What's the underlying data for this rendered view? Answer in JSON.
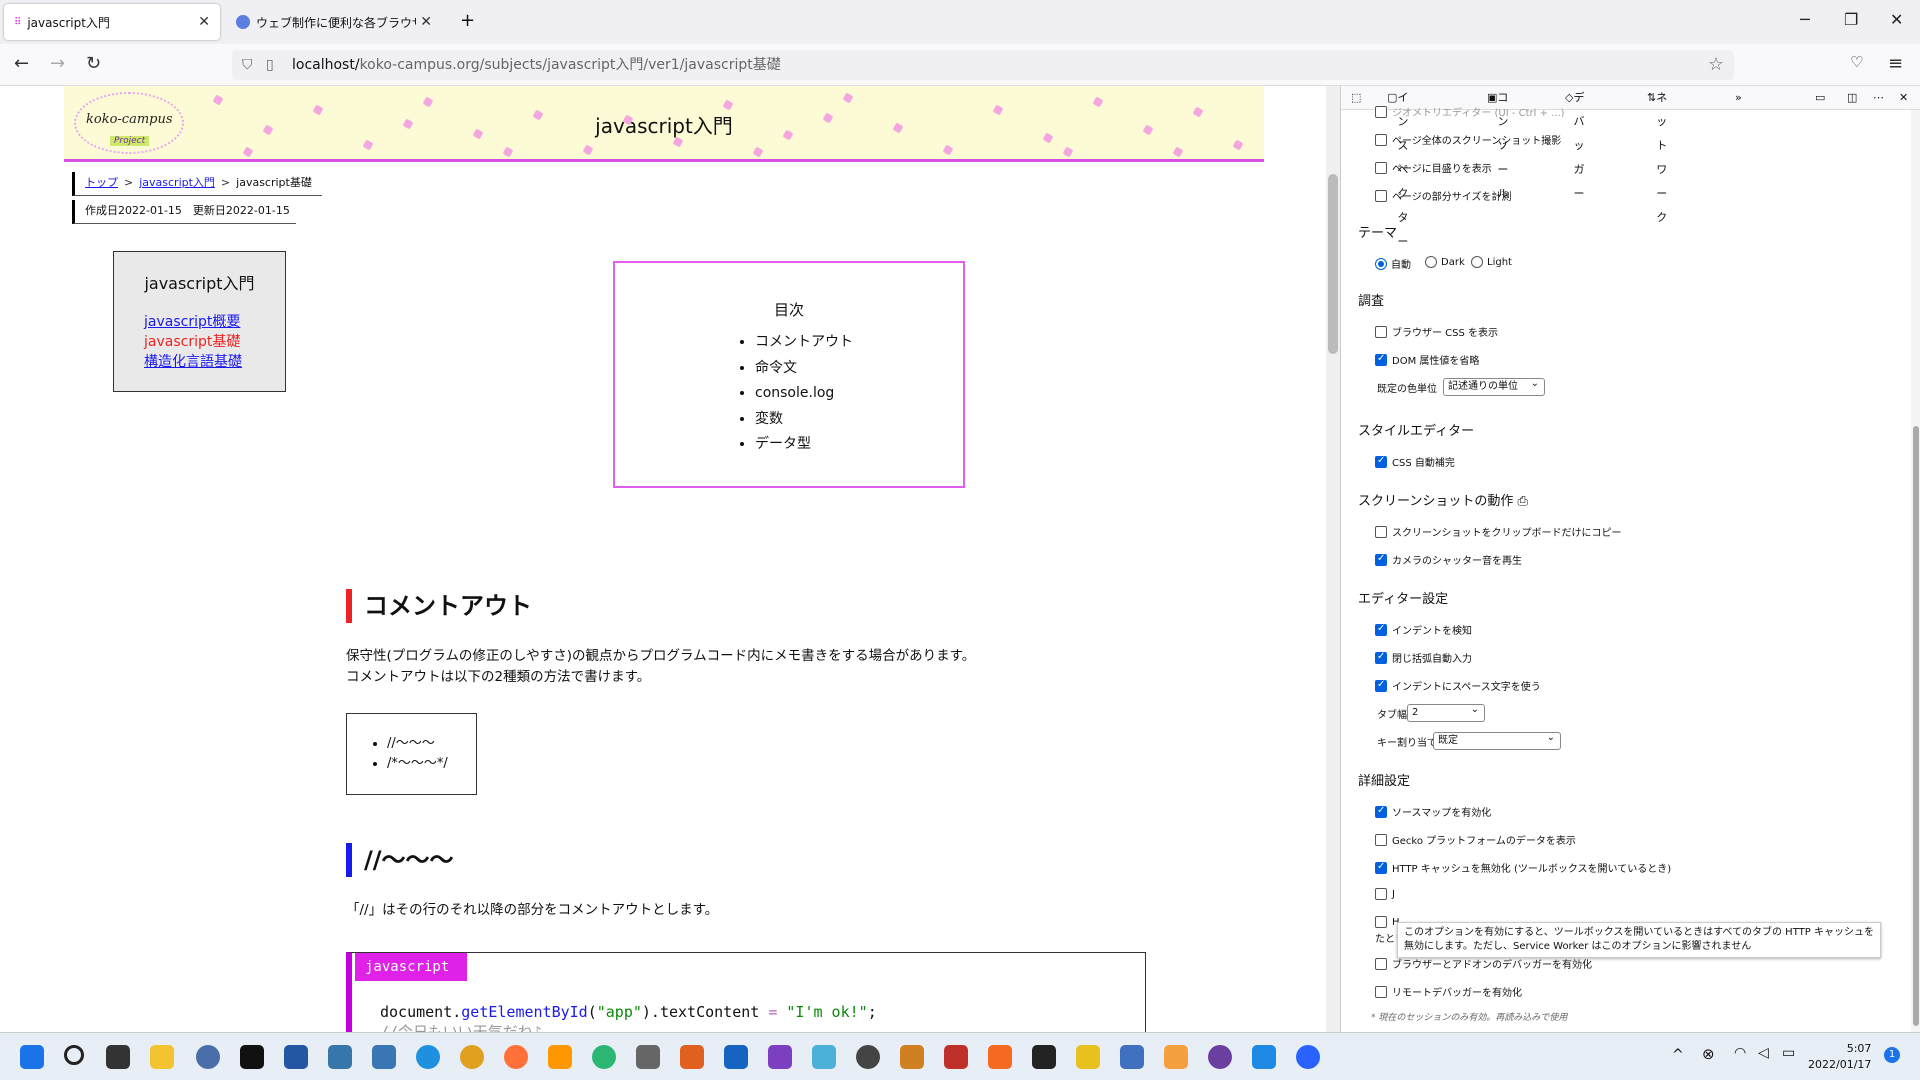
{
  "browser": {
    "tabs": [
      {
        "title": "javascript入門"
      },
      {
        "title": "ウェブ制作に便利な各ブラウザの開発..."
      }
    ],
    "new_tab": "+",
    "url_prefix": "localhost/",
    "url_rest": "koko-campus.org/subjects/javascript入門/ver1/javascript基礎",
    "window_controls": {
      "minimize": "─",
      "restore": "❐",
      "close": "✕"
    }
  },
  "page": {
    "site_title": "javascript入門",
    "logo_text": "koko-campus",
    "logo_sub": "Project",
    "breadcrumb": {
      "top": "トップ",
      "course": "javascript入門",
      "current": "javascript基礎",
      "sep": ">"
    },
    "dates": "作成日2022-01-15　更新日2022-01-15",
    "sidebar": {
      "title": "javascript入門",
      "links": [
        "javascript概要",
        "javascript基礎",
        "構造化言語基礎"
      ]
    },
    "toc": {
      "title": "目次",
      "items": [
        "コメントアウト",
        "命令文",
        "console.log",
        "変数",
        "データ型"
      ]
    },
    "section1": {
      "heading": "コメントアウト",
      "line1": "保守性(プログラムの修正のしやすさ)の観点からプログラムコード内にメモ書きをする場合があります。",
      "line2": "コメントアウトは以下の2種類の方法で書けます。",
      "list": [
        "//～～～",
        "/*～～～*/"
      ]
    },
    "section2": {
      "heading": "//～～～",
      "text": "「//」はその行のそれ以降の部分をコメントアウトとします。",
      "code_lang": "javascript",
      "code": {
        "obj": "document",
        "dot": ".",
        "fn": "getElementById",
        "arg": "\"app\"",
        "prop": ").textContent ",
        "eq": "=",
        "val": " \"I'm ok!\"",
        "end": ";",
        "comment": "//今日もいい天気だね♪"
      }
    }
  },
  "devtools": {
    "tabs": [
      "インスペクター",
      "コンソール",
      "デバッガー",
      "ネットワーク"
    ],
    "cut_top_item": "ジオメトリエディター (UI - Ctrl + ...)",
    "screenshot_items": [
      {
        "label": "ページ全体のスクリーンショット撮影",
        "checked": false
      },
      {
        "label": "ページに目盛りを表示",
        "checked": false
      },
      {
        "label": "ページの部分サイズを計測",
        "checked": false
      }
    ],
    "theme": {
      "title": "テーマ",
      "options": [
        "自動",
        "Dark",
        "Light"
      ],
      "selected": "自動"
    },
    "inspect": {
      "title": "調査",
      "items": [
        {
          "label": "ブラウザー CSS を表示",
          "checked": false
        },
        {
          "label": "DOM 属性値を省略",
          "checked": true
        }
      ],
      "color_unit_label": "既定の色単位",
      "color_unit_value": "記述通りの単位"
    },
    "style_editor": {
      "title": "スタイルエディター",
      "items": [
        {
          "label": "CSS 自動補完",
          "checked": true
        }
      ]
    },
    "screenshot_behavior": {
      "title": "スクリーンショットの動作",
      "items": [
        {
          "label": "スクリーンショットをクリップボードだけにコピー",
          "checked": false
        },
        {
          "label": "カメラのシャッター音を再生",
          "checked": true
        }
      ]
    },
    "editor": {
      "title": "エディター設定",
      "items": [
        {
          "label": "インデントを検知",
          "checked": true
        },
        {
          "label": "閉じ括弧自動入力",
          "checked": true
        },
        {
          "label": "インデントにスペース文字を使う",
          "checked": true
        }
      ],
      "tab_width_label": "タブ幅",
      "tab_width_value": "2",
      "keymap_label": "キー割り当て",
      "keymap_value": "既定"
    },
    "advanced": {
      "title": "詳細設定",
      "items": [
        {
          "label": "ソースマップを有効化",
          "checked": true
        },
        {
          "label": "Gecko プラットフォームのデータを表示",
          "checked": false
        },
        {
          "label": "HTTP キャッシュを無効化 (ツールボックスを開いているとき)",
          "checked": true
        },
        {
          "label": "J",
          "checked": false
        },
        {
          "label": "H",
          "checked": false
        },
        {
          "label": "ブラウザーとアドオンのデバッガーを有効化",
          "checked": false
        },
        {
          "label": "リモートデバッガーを有効化",
          "checked": false
        }
      ],
      "wrap_fragment": "たとき)",
      "footnote": "* 現在のセッションのみ有効。再読み込みで使用"
    },
    "tooltip": "このオプションを有効にすると、ツールボックスを開いているときはすべてのタブの HTTP キャッシュを無効にします。ただし、Service Worker はこのオプションに影響されません"
  },
  "taskbar": {
    "time": "5:07",
    "date": "2022/01/17",
    "badge": "1"
  },
  "colors": {
    "accent_pink": "#e021e8",
    "heading_red": "#ee2222",
    "heading_blue": "#1a1aee",
    "checkbox_blue": "#0060df"
  }
}
